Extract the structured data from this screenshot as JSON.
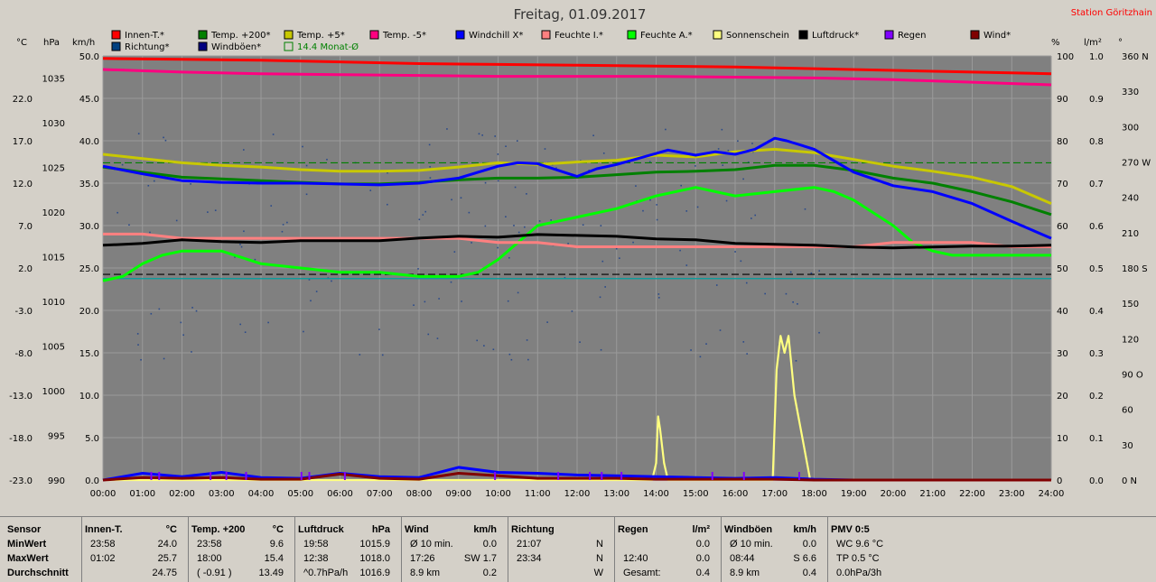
{
  "title": "Freitag, 01.09.2017",
  "station": "Station Göritzhain",
  "axis_units": {
    "celsius": "°C",
    "hpa": "hPa",
    "kmh": "km/h",
    "percent": "%",
    "lm2": "l/m²",
    "deg": "°"
  },
  "legend": [
    {
      "label": "Innen-T.*",
      "color": "#ff0000"
    },
    {
      "label": "Temp. +200*",
      "color": "#008000"
    },
    {
      "label": "Temp. +5*",
      "color": "#c8c800"
    },
    {
      "label": "Temp. -5*",
      "color": "#ff0080"
    },
    {
      "label": "Windchill X*",
      "color": "#0000ff"
    },
    {
      "label": "Feuchte I.*",
      "color": "#ff8080"
    },
    {
      "label": "Feuchte A.*",
      "color": "#00ff00"
    },
    {
      "label": "Sonnenschein",
      "color": "#ffff80"
    },
    {
      "label": "Luftdruck*",
      "color": "#000000"
    },
    {
      "label": "Regen",
      "color": "#8000ff"
    },
    {
      "label": "Wind*",
      "color": "#800000"
    },
    {
      "label": "Richtung*",
      "color": "#004080"
    },
    {
      "label": "Windböen*",
      "color": "#000080"
    },
    {
      "label": "14.4 Monat-Ø",
      "color": "#00ff00"
    }
  ],
  "chart_data": {
    "type": "line",
    "title": "Freitag, 01.09.2017",
    "xlabel": "",
    "x_ticks": [
      "00:00",
      "01:00",
      "02:00",
      "03:00",
      "04:00",
      "05:00",
      "06:00",
      "07:00",
      "08:00",
      "09:00",
      "10:00",
      "11:00",
      "12:00",
      "13:00",
      "14:00",
      "15:00",
      "16:00",
      "17:00",
      "18:00",
      "19:00",
      "20:00",
      "21:00",
      "22:00",
      "23:00",
      "24:00"
    ],
    "axes": {
      "celsius": {
        "ticks": [
          "22.0",
          "17.0",
          "12.0",
          "7.0",
          "2.0",
          "-3.0",
          "-8.0",
          "-13.0",
          "-18.0",
          "-23.0"
        ],
        "range": [
          -23,
          27
        ]
      },
      "hpa": {
        "ticks": [
          "1035",
          "1030",
          "1025",
          "1020",
          "1015",
          "1010",
          "1005",
          "1000",
          "995",
          "990"
        ],
        "range": [
          990,
          1037.5
        ]
      },
      "kmh": {
        "ticks": [
          "50.0",
          "45.0",
          "40.0",
          "35.0",
          "30.0",
          "25.0",
          "20.0",
          "15.0",
          "10.0",
          "5.0",
          "0.0"
        ],
        "range": [
          0,
          50
        ]
      },
      "percent": {
        "ticks": [
          "100",
          "90",
          "80",
          "70",
          "60",
          "50",
          "40",
          "30",
          "20",
          "10",
          "0"
        ],
        "range": [
          0,
          100
        ]
      },
      "lm2": {
        "ticks": [
          "1.0",
          "0.9",
          "0.8",
          "0.7",
          "0.6",
          "0.5",
          "0.4",
          "0.3",
          "0.2",
          "0.1",
          "0.0"
        ],
        "range": [
          0,
          1
        ]
      },
      "deg": {
        "ticks": [
          "360 N",
          "330",
          "300",
          "270 W",
          "240",
          "210",
          "180 S",
          "150",
          "120",
          "90 O",
          "60",
          "30",
          "0 N"
        ],
        "range": [
          0,
          360
        ]
      }
    },
    "grid": true,
    "legend_position": "top",
    "series": [
      {
        "name": "Innen-T.*",
        "axis": "celsius",
        "color": "#ff0000",
        "x": [
          0,
          2,
          4,
          6,
          8,
          10,
          12,
          14,
          16,
          18,
          20,
          22,
          24
        ],
        "y": [
          26.7,
          26.6,
          26.5,
          26.3,
          26.1,
          26.0,
          25.9,
          25.8,
          25.7,
          25.5,
          25.3,
          25.1,
          24.9
        ]
      },
      {
        "name": "Temp. -5*",
        "axis": "celsius",
        "color": "#ff0080",
        "x": [
          0,
          2,
          4,
          6,
          8,
          10,
          12,
          14,
          16,
          18,
          20,
          22,
          24
        ],
        "y": [
          25.4,
          25.1,
          24.9,
          24.8,
          24.7,
          24.6,
          24.6,
          24.6,
          24.5,
          24.4,
          24.2,
          23.9,
          23.6
        ]
      },
      {
        "name": "Temp. +5*",
        "axis": "celsius",
        "color": "#c8c800",
        "x": [
          0,
          1,
          2,
          3,
          4,
          5,
          6,
          7,
          8,
          9,
          10,
          11,
          12,
          13,
          14,
          15,
          16,
          17,
          18,
          19,
          20,
          21,
          22,
          23,
          24
        ],
        "y": [
          15.4,
          14.9,
          14.4,
          14.1,
          13.9,
          13.6,
          13.4,
          13.4,
          13.5,
          13.9,
          14.4,
          14.2,
          14.5,
          14.7,
          15.3,
          15.1,
          15.7,
          16.0,
          15.6,
          14.8,
          14.0,
          13.4,
          12.7,
          11.6,
          9.6
        ]
      },
      {
        "name": "Temp. +200*",
        "axis": "celsius",
        "color": "#008000",
        "x": [
          0,
          1,
          2,
          3,
          4,
          5,
          6,
          7,
          8,
          9,
          10,
          11,
          12,
          13,
          14,
          15,
          16,
          17,
          18,
          19,
          20,
          21,
          22,
          23,
          24
        ],
        "y": [
          13.9,
          13.3,
          12.7,
          12.5,
          12.3,
          12.1,
          11.9,
          11.9,
          12.1,
          12.4,
          12.6,
          12.6,
          12.7,
          13.0,
          13.3,
          13.4,
          13.6,
          14.1,
          14.1,
          13.5,
          12.6,
          12.0,
          11.0,
          9.8,
          8.3
        ]
      },
      {
        "name": "Windchill X*",
        "axis": "celsius",
        "color": "#0000ff",
        "x": [
          0,
          1,
          2,
          3,
          4,
          5,
          6,
          7,
          8,
          9,
          10,
          10.5,
          11,
          12,
          12.5,
          13,
          14,
          14.3,
          15,
          15.5,
          16,
          16.5,
          17,
          17.3,
          18,
          19,
          20,
          21,
          22,
          23,
          24
        ],
        "y": [
          14.0,
          13.1,
          12.3,
          12.1,
          12.0,
          12.0,
          11.9,
          11.8,
          12.0,
          12.6,
          14.0,
          14.4,
          14.3,
          12.8,
          13.7,
          14.2,
          15.5,
          15.9,
          15.3,
          15.7,
          15.4,
          16.0,
          17.3,
          17.0,
          16.0,
          13.3,
          11.7,
          11.0,
          9.6,
          7.5,
          5.5
        ]
      },
      {
        "name": "Feuchte A.*",
        "axis": "percent",
        "color": "#00ff00",
        "x": [
          0,
          0.5,
          1,
          1.5,
          2,
          3,
          4,
          5,
          6,
          7,
          8,
          9,
          9.5,
          10,
          10.5,
          11,
          12,
          13,
          14,
          15,
          16,
          17,
          18,
          18.5,
          19,
          19.5,
          20,
          20.5,
          21,
          21.5,
          22,
          23,
          24
        ],
        "y": [
          47,
          48,
          51,
          53,
          54,
          54,
          51,
          50,
          49,
          49,
          48,
          48,
          49,
          52,
          56,
          60,
          62,
          64,
          67,
          69,
          67,
          68,
          69,
          68,
          66,
          63,
          60,
          56,
          54,
          53,
          53,
          53,
          53
        ]
      },
      {
        "name": "Feuchte I.*",
        "axis": "percent",
        "color": "#ff8080",
        "x": [
          0,
          1,
          2,
          3,
          4,
          5,
          6,
          7,
          8,
          9,
          10,
          11,
          12,
          13,
          14,
          15,
          16,
          17,
          18,
          19,
          20,
          21,
          22,
          23,
          24
        ],
        "y": [
          58,
          58,
          57,
          57,
          57,
          57,
          57,
          57,
          57,
          57,
          56,
          56,
          55,
          55,
          55,
          55,
          55,
          55,
          55,
          55,
          56,
          56,
          56,
          55,
          55
        ]
      },
      {
        "name": "Luftdruck*",
        "axis": "hpa",
        "color": "#000000",
        "x": [
          0,
          1,
          2,
          3,
          4,
          5,
          6,
          7,
          8,
          9,
          10,
          11,
          12,
          13,
          14,
          15,
          16,
          17,
          18,
          19,
          20,
          21,
          22,
          23,
          24
        ],
        "y": [
          1016.3,
          1016.5,
          1016.9,
          1016.7,
          1016.6,
          1016.8,
          1016.8,
          1016.8,
          1017.1,
          1017.3,
          1017.2,
          1017.5,
          1017.4,
          1017.3,
          1017.0,
          1016.9,
          1016.5,
          1016.4,
          1016.3,
          1016.1,
          1016.0,
          1016.1,
          1016.2,
          1016.2,
          1016.3
        ]
      },
      {
        "name": "Sonnenschein",
        "axis": "kmh",
        "color": "#ffff80",
        "x": [
          0,
          13.9,
          14.0,
          14.05,
          14.1,
          14.2,
          14.3,
          16.8,
          16.95,
          17.05,
          17.15,
          17.25,
          17.35,
          17.5,
          17.7,
          17.9,
          24
        ],
        "y": [
          0,
          0,
          2,
          7.5,
          6,
          2,
          0,
          0,
          0,
          13,
          17,
          15,
          17,
          10,
          5,
          0,
          0
        ]
      },
      {
        "name": "Windböen*",
        "axis": "kmh",
        "color": "#0000ff",
        "x": [
          0,
          1,
          2,
          3,
          4,
          5,
          6,
          7,
          8,
          9,
          10,
          11,
          12,
          13,
          14,
          15,
          16,
          17,
          18,
          19,
          20,
          21,
          22,
          23,
          24
        ],
        "y": [
          0,
          0.8,
          0.4,
          0.9,
          0.3,
          0.2,
          0.8,
          0.4,
          0.3,
          1.5,
          0.9,
          0.8,
          0.6,
          0.5,
          0.4,
          0.3,
          0.2,
          0.3,
          0.1,
          0,
          0,
          0,
          0,
          0,
          0
        ]
      },
      {
        "name": "Wind*",
        "axis": "kmh",
        "color": "#800000",
        "x": [
          0,
          1,
          2,
          3,
          4,
          5,
          6,
          7,
          8,
          9,
          10,
          11,
          12,
          13,
          14,
          15,
          16,
          17,
          18,
          19,
          20,
          21,
          22,
          23,
          24
        ],
        "y": [
          0,
          0.3,
          0.2,
          0.3,
          0.1,
          0.1,
          0.7,
          0.2,
          0.1,
          0.8,
          0.5,
          0.2,
          0.2,
          0.2,
          0.1,
          0.1,
          0.1,
          0.1,
          0,
          0,
          0,
          0,
          0,
          0,
          0
        ]
      }
    ],
    "reference_lines": [
      {
        "name": "14.4 Monat-Ø",
        "axis": "celsius",
        "y": 14.4,
        "color": "#008000",
        "dash": true
      },
      {
        "axis": "percent",
        "y": 48.5,
        "color": "#000000",
        "dash": true
      },
      {
        "axis": "percent",
        "y": 47.5,
        "color": "#00a0a0",
        "dash": false
      }
    ]
  },
  "stats": {
    "columns": [
      {
        "header": "Sensor",
        "rows": [
          "MinWert",
          "MaxWert",
          "Durchschnitt"
        ]
      },
      {
        "header": "Innen-T.",
        "unit": "°C",
        "rows": [
          [
            "23:58",
            "24.0"
          ],
          [
            "01:02",
            "25.7"
          ],
          [
            "",
            "24.75"
          ]
        ]
      },
      {
        "header": "Temp. +200",
        "unit": "°C",
        "rows": [
          [
            "23:58",
            "9.6"
          ],
          [
            "18:00",
            "15.4"
          ],
          [
            "( -0.91 )",
            "13.49"
          ]
        ]
      },
      {
        "header": "Luftdruck",
        "unit": "hPa",
        "rows": [
          [
            "19:58",
            "1015.9"
          ],
          [
            "12:38",
            "1018.0"
          ],
          [
            "^0.7hPa/h",
            "1016.9"
          ]
        ]
      },
      {
        "header": "Wind",
        "unit": "km/h",
        "rows": [
          [
            "Ø 10 min.",
            "0.0"
          ],
          [
            "17:26",
            "SW 1.7"
          ],
          [
            "8.9 km",
            "0.2"
          ]
        ]
      },
      {
        "header": "Richtung",
        "unit": "",
        "rows": [
          [
            "21:07",
            "N"
          ],
          [
            "23:34",
            "N"
          ],
          [
            "",
            "W"
          ]
        ]
      },
      {
        "header": "Regen",
        "unit": "l/m²",
        "rows": [
          [
            "",
            "0.0"
          ],
          [
            "12:40",
            "0.0"
          ],
          [
            "Gesamt:",
            "0.4"
          ]
        ]
      },
      {
        "header": "Windböen",
        "unit": "km/h",
        "rows": [
          [
            "Ø 10 min.",
            "0.0"
          ],
          [
            "08:44",
            "S 6.6"
          ],
          [
            "8.9 km",
            "0.4"
          ]
        ]
      },
      {
        "header": "PMV 0:5",
        "unit": "",
        "rows": [
          [
            "WC 9.6 °C",
            ""
          ],
          [
            "TP 0.5 °C",
            ""
          ],
          [
            "0.0hPa/3h",
            ""
          ]
        ]
      }
    ]
  }
}
